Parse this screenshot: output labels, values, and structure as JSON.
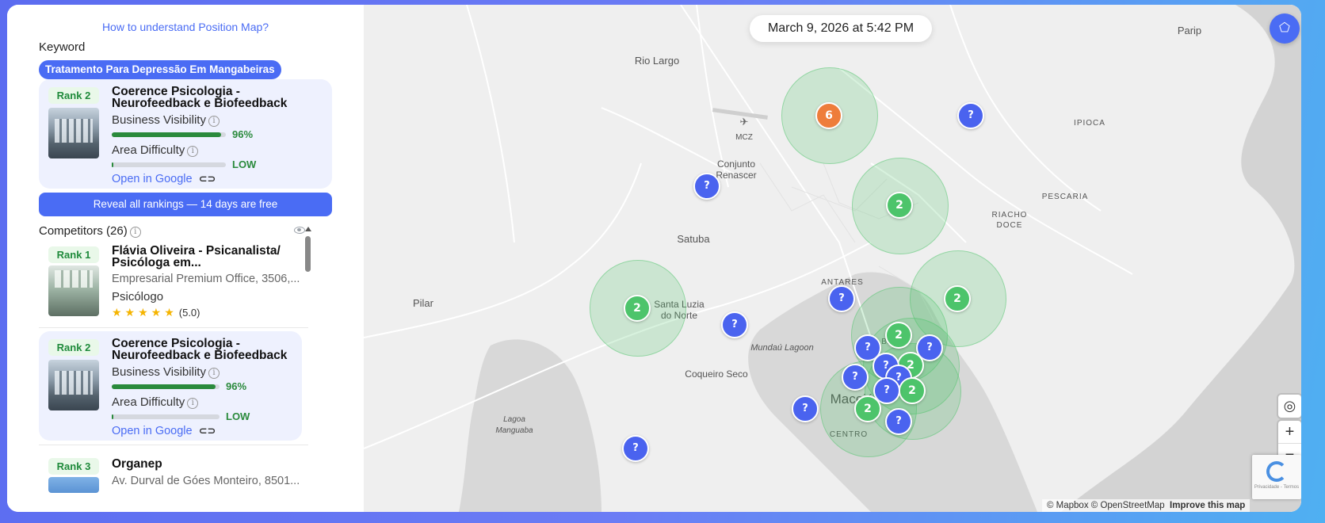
{
  "sidebar": {
    "help_link": "How to understand Position Map?",
    "keyword_label": "Keyword",
    "keyword": "Tratamento Para Depressão Em Mangabeiras",
    "my_business": {
      "rank": "Rank 2",
      "name": "Coerence Psicologia - Neurofeedback e Biofeedback",
      "visibility_label": "Business Visibility",
      "visibility_value": "96%",
      "visibility_fraction": 0.96,
      "difficulty_label": "Area Difficulty",
      "difficulty_value": "LOW",
      "open_google": "Open in Google"
    },
    "reveal_button": "Reveal all rankings — 14 days are free",
    "competitors_label": "Competitors (26)",
    "competitors": [
      {
        "rank": "Rank 1",
        "name": "Flávia Oliveira - Psicanalista/ Psicóloga em...",
        "address": "Empresarial Premium Office, 3506,...",
        "category": "Psicólogo",
        "stars": "★★★★★",
        "rating": "(5.0)"
      },
      {
        "rank": "Rank 2",
        "name": "Coerence Psicologia - Neurofeedback e Biofeedback",
        "visibility_label": "Business Visibility",
        "visibility_value": "96%",
        "difficulty_label": "Area Difficulty",
        "difficulty_value": "LOW",
        "open_google": "Open in Google"
      },
      {
        "rank": "Rank 3",
        "name": "Organep",
        "address": "Av. Durval de Góes Monteiro, 8501..."
      }
    ]
  },
  "map": {
    "timestamp": "March 9, 2026 at 5:42 PM",
    "labels": {
      "rio_largo": "Rio Largo",
      "mcz": "MCZ",
      "conjunto": "Conjunto",
      "renascer": "Renascer",
      "satuba": "Satuba",
      "antares": "ANTARES",
      "pilar": "Pilar",
      "santa_luzia_1": "Santa Luzia",
      "santa_luzia_2": "do Norte",
      "mundau": "Mundaú Lagoon",
      "coqueiro": "Coqueiro Seco",
      "lagoa_1": "Lagoa",
      "lagoa_2": "Manguaba",
      "centro": "CENTRO",
      "maceio": "Maceió",
      "pescaria": "PESCARIA",
      "riacho_1": "RIACHO",
      "riacho_2": "DOCE",
      "ipioca": "IPIOCA",
      "paripueira": "Parip",
      "barro": "BAR"
    },
    "markers": {
      "q": "?",
      "six": "6",
      "two": "2"
    },
    "attribution_left": "© Mapbox © OpenStreetMap",
    "attribution_right": "Improve this map",
    "recaptcha": "Privacidade - Termos"
  },
  "colors": {
    "accent": "#4a6cf4",
    "green": "#2a8a3c",
    "marker_blue": "#4a63ef",
    "marker_green": "#4dc46b",
    "marker_orange": "#ee7d3b"
  },
  "icons": [
    "info-icon",
    "link-icon",
    "eye-icon",
    "locate-icon",
    "plus-icon",
    "minus-icon",
    "compass-icon",
    "grid-icon",
    "star-icon"
  ]
}
